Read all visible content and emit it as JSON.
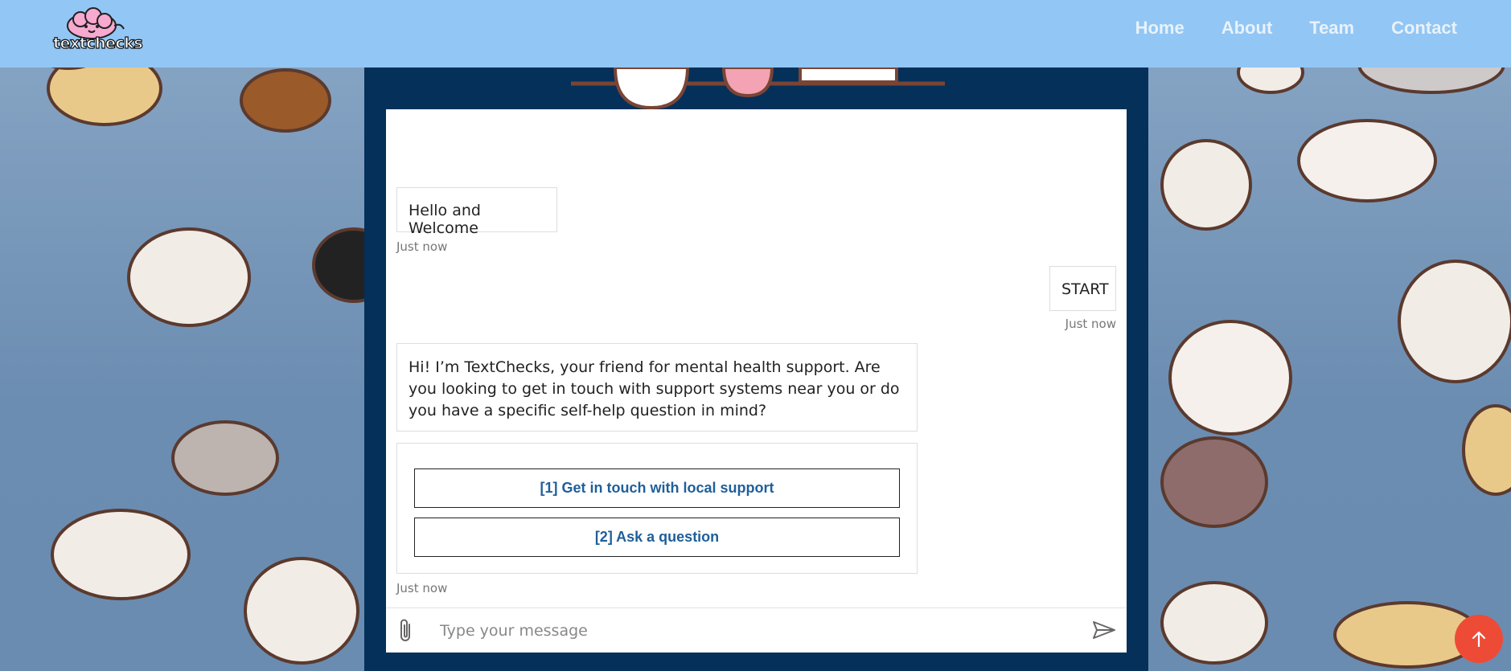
{
  "header": {
    "logo_text": "textchecks",
    "nav": [
      {
        "label": "Home"
      },
      {
        "label": "About"
      },
      {
        "label": "Team"
      },
      {
        "label": "Contact"
      }
    ]
  },
  "chat": {
    "messages": [
      {
        "from": "bot",
        "text": "Hello and Welcome",
        "time": "Just now"
      },
      {
        "from": "user",
        "text": "START",
        "time": "Just now"
      },
      {
        "from": "bot",
        "text": "Hi! I’m TextChecks, your friend for mental health support. Are you looking to get in touch with support systems near you or do you have a specific self-help question in mind?",
        "time": ""
      }
    ],
    "options": [
      {
        "label": "[1] Get in touch with local support"
      },
      {
        "label": "[2] Ask a question"
      }
    ],
    "options_time": "Just now",
    "composer": {
      "placeholder": "Type your message"
    }
  },
  "colors": {
    "navbar": "#92c6f4",
    "frame": "#05305a",
    "option_text": "#1f5f9a",
    "scroll_top": "#ee4b37"
  },
  "icons": [
    "paperclip-icon",
    "send-icon",
    "arrow-up-icon",
    "logo-brain-icon"
  ]
}
